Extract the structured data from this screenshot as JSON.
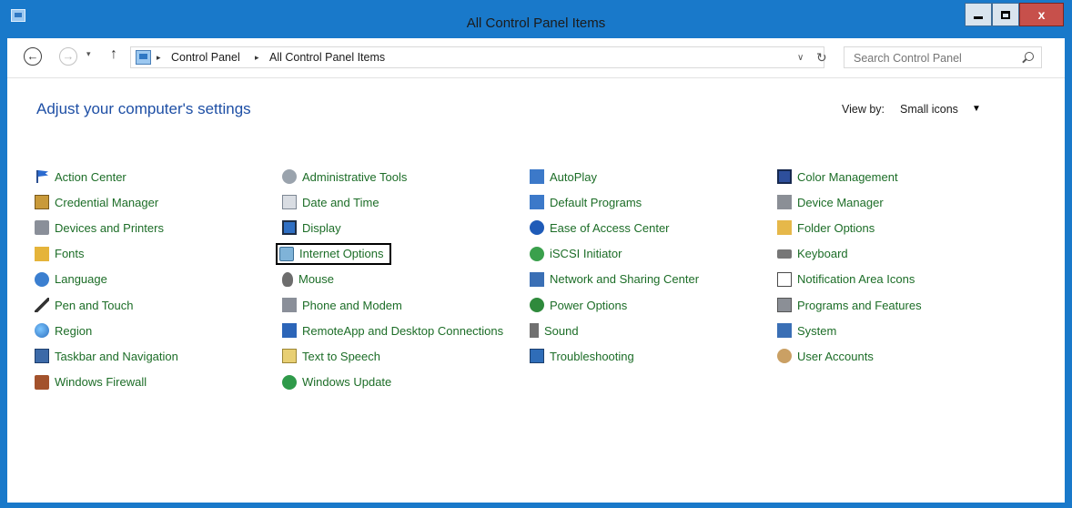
{
  "window": {
    "title": "All Control Panel Items",
    "controls": {
      "minimize": "–",
      "maximize": "□",
      "close": "x"
    }
  },
  "nav": {
    "back": "←",
    "forward": "→",
    "recent": "▾",
    "up": "↑",
    "breadcrumb": [
      "Control Panel",
      "All Control Panel Items"
    ],
    "breadcrumb_sep": "▸",
    "address_dropdown": "∨",
    "refresh": "↻",
    "search_placeholder": "Search Control Panel"
  },
  "main": {
    "heading": "Adjust your computer's settings",
    "view_by_label": "View by:",
    "view_by_value": "Small icons",
    "view_by_caret": "▼",
    "highlighted_item": "Internet Options",
    "link_color": "#1c6d27",
    "heading_color": "#1e4fa5",
    "columns": [
      [
        {
          "label": "Action Center",
          "icon": "flag-icon"
        },
        {
          "label": "Credential Manager",
          "icon": "vault-icon"
        },
        {
          "label": "Devices and Printers",
          "icon": "printer-icon"
        },
        {
          "label": "Fonts",
          "icon": "font-icon"
        },
        {
          "label": "Language",
          "icon": "language-icon"
        },
        {
          "label": "Pen and Touch",
          "icon": "pen-icon"
        },
        {
          "label": "Region",
          "icon": "globe-icon"
        },
        {
          "label": "Taskbar and Navigation",
          "icon": "taskbar-icon"
        },
        {
          "label": "Windows Firewall",
          "icon": "firewall-icon"
        }
      ],
      [
        {
          "label": "Administrative Tools",
          "icon": "admin-tools-icon"
        },
        {
          "label": "Date and Time",
          "icon": "calendar-clock-icon"
        },
        {
          "label": "Display",
          "icon": "monitor-icon"
        },
        {
          "label": "Internet Options",
          "icon": "internet-options-icon"
        },
        {
          "label": "Mouse",
          "icon": "mouse-icon"
        },
        {
          "label": "Phone and Modem",
          "icon": "phone-icon"
        },
        {
          "label": "RemoteApp and Desktop Connections",
          "icon": "remote-desktop-icon"
        },
        {
          "label": "Text to Speech",
          "icon": "speech-icon"
        },
        {
          "label": "Windows Update",
          "icon": "update-icon"
        }
      ],
      [
        {
          "label": "AutoPlay",
          "icon": "autoplay-icon"
        },
        {
          "label": "Default Programs",
          "icon": "default-programs-icon"
        },
        {
          "label": "Ease of Access Center",
          "icon": "accessibility-icon"
        },
        {
          "label": "iSCSI Initiator",
          "icon": "iscsi-icon"
        },
        {
          "label": "Network and Sharing Center",
          "icon": "network-icon"
        },
        {
          "label": "Power Options",
          "icon": "power-icon"
        },
        {
          "label": "Sound",
          "icon": "speaker-icon"
        },
        {
          "label": "Troubleshooting",
          "icon": "troubleshoot-icon"
        }
      ],
      [
        {
          "label": "Color Management",
          "icon": "color-management-icon"
        },
        {
          "label": "Device Manager",
          "icon": "device-manager-icon"
        },
        {
          "label": "Folder Options",
          "icon": "folder-icon"
        },
        {
          "label": "Keyboard",
          "icon": "keyboard-icon"
        },
        {
          "label": "Notification Area Icons",
          "icon": "notification-icon"
        },
        {
          "label": "Programs and Features",
          "icon": "programs-icon"
        },
        {
          "label": "System",
          "icon": "system-icon"
        },
        {
          "label": "User Accounts",
          "icon": "users-icon"
        }
      ]
    ]
  }
}
